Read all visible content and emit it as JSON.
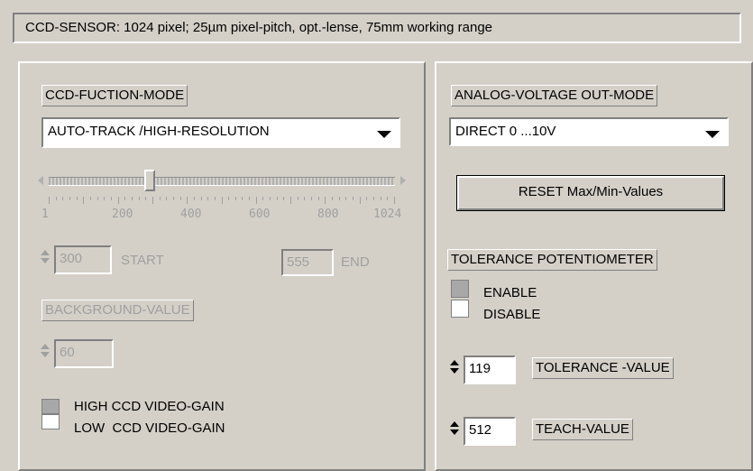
{
  "header": {
    "text": "CCD-SENSOR: 1024 pixel; 25µm pixel-pitch, opt.-lense, 75mm working range"
  },
  "left_panel": {
    "mode_label": "CCD-FUCTION-MODE",
    "mode_select": "AUTO-TRACK /HIGH-RESOLUTION",
    "slider": {
      "ticks": [
        "1",
        "200",
        "400",
        "600",
        "800",
        "1024"
      ],
      "value": 300,
      "min": 1,
      "max": 1024
    },
    "start_value": "300",
    "start_label": "START",
    "end_value": "555",
    "end_label": "END",
    "background_label": "BACKGROUND-VALUE",
    "background_value": "60",
    "gain_high": "HIGH CCD VIDEO-GAIN",
    "gain_low": "LOW  CCD VIDEO-GAIN"
  },
  "right_panel": {
    "analog_label": "ANALOG-VOLTAGE OUT-MODE",
    "analog_select": "DIRECT 0 ...10V",
    "reset_button": "RESET Max/Min-Values",
    "tolerance_label": "TOLERANCE POTENTIOMETER",
    "enable": "ENABLE",
    "disable": "DISABLE",
    "tolerance_value": "119",
    "tolerance_value_label": "TOLERANCE -VALUE",
    "teach_value": "512",
    "teach_value_label": "TEACH-VALUE"
  }
}
